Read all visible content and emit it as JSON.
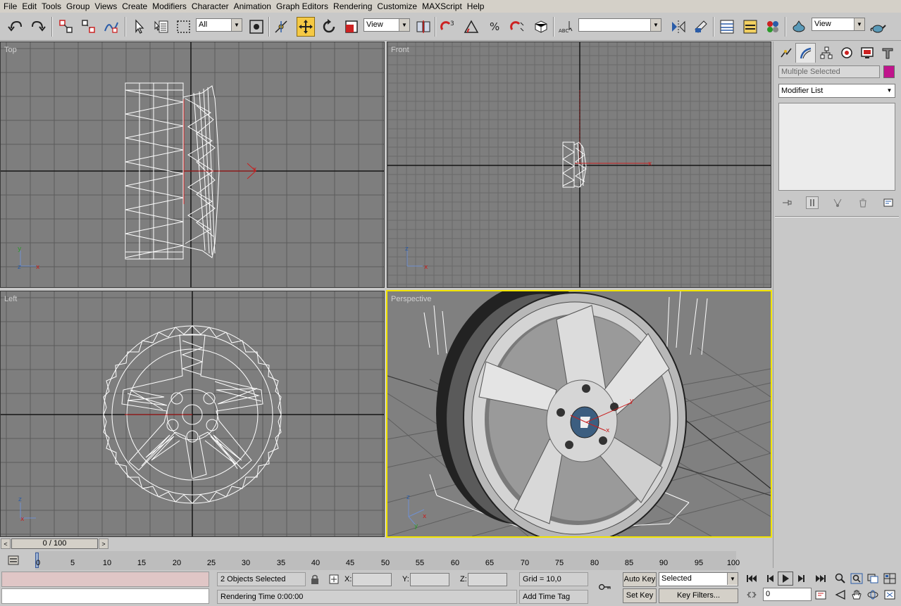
{
  "menu": [
    "File",
    "Edit",
    "Tools",
    "Group",
    "Views",
    "Create",
    "Modifiers",
    "Character",
    "Animation",
    "Graph Editors",
    "Rendering",
    "Customize",
    "MAXScript",
    "Help"
  ],
  "toolbar": {
    "selection_filter": "All",
    "ref_coord_system": "View",
    "named_selection": "",
    "render_view": "View"
  },
  "viewports": {
    "top": "Top",
    "front": "Front",
    "left": "Left",
    "perspective": "Perspective"
  },
  "axis_letters": {
    "x": "x",
    "y": "y",
    "z": "z"
  },
  "command_panel": {
    "object_name": "Multiple Selected",
    "object_color": "#c0148c",
    "modifier_list": "Modifier List"
  },
  "time_slider": {
    "position": "0 / 100"
  },
  "trackbar_ticks": [
    "0",
    "5",
    "10",
    "15",
    "20",
    "25",
    "30",
    "35",
    "40",
    "45",
    "50",
    "55",
    "60",
    "65",
    "70",
    "75",
    "80",
    "85",
    "90",
    "95",
    "100"
  ],
  "status": {
    "selection_count": "2 Objects Selected",
    "prompt": "Rendering Time  0:00:00",
    "x_label": "X:",
    "y_label": "Y:",
    "z_label": "Z:",
    "x_value": "",
    "y_value": "",
    "z_value": "",
    "grid": "Grid = 10,0",
    "add_time_tag": "Add Time Tag",
    "auto_key": "Auto Key",
    "set_key": "Set Key",
    "key_mode": "Selected",
    "key_filters": "Key Filters...",
    "current_frame": "0"
  },
  "colors": {
    "viewport_bg": "#7e7e7e",
    "active_viewport_border": "#f2e400",
    "active_tool": "#f5c944"
  }
}
